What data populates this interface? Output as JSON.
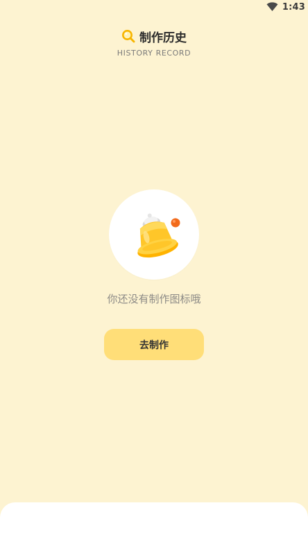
{
  "status_bar": {
    "time": "1:43",
    "wifi_icon": "wifi-icon"
  },
  "header": {
    "title": "制作历史",
    "subtitle": "HISTORY RECORD",
    "title_icon": "search-icon"
  },
  "empty_state": {
    "illustration": "bell-icon",
    "message": "你还没有制作图标哦",
    "button_label": "去制作"
  },
  "colors": {
    "background": "#FDF3D1",
    "button": "#FFDE78",
    "accent_yellow": "#FFC629",
    "accent_orange": "#F26A1B"
  }
}
